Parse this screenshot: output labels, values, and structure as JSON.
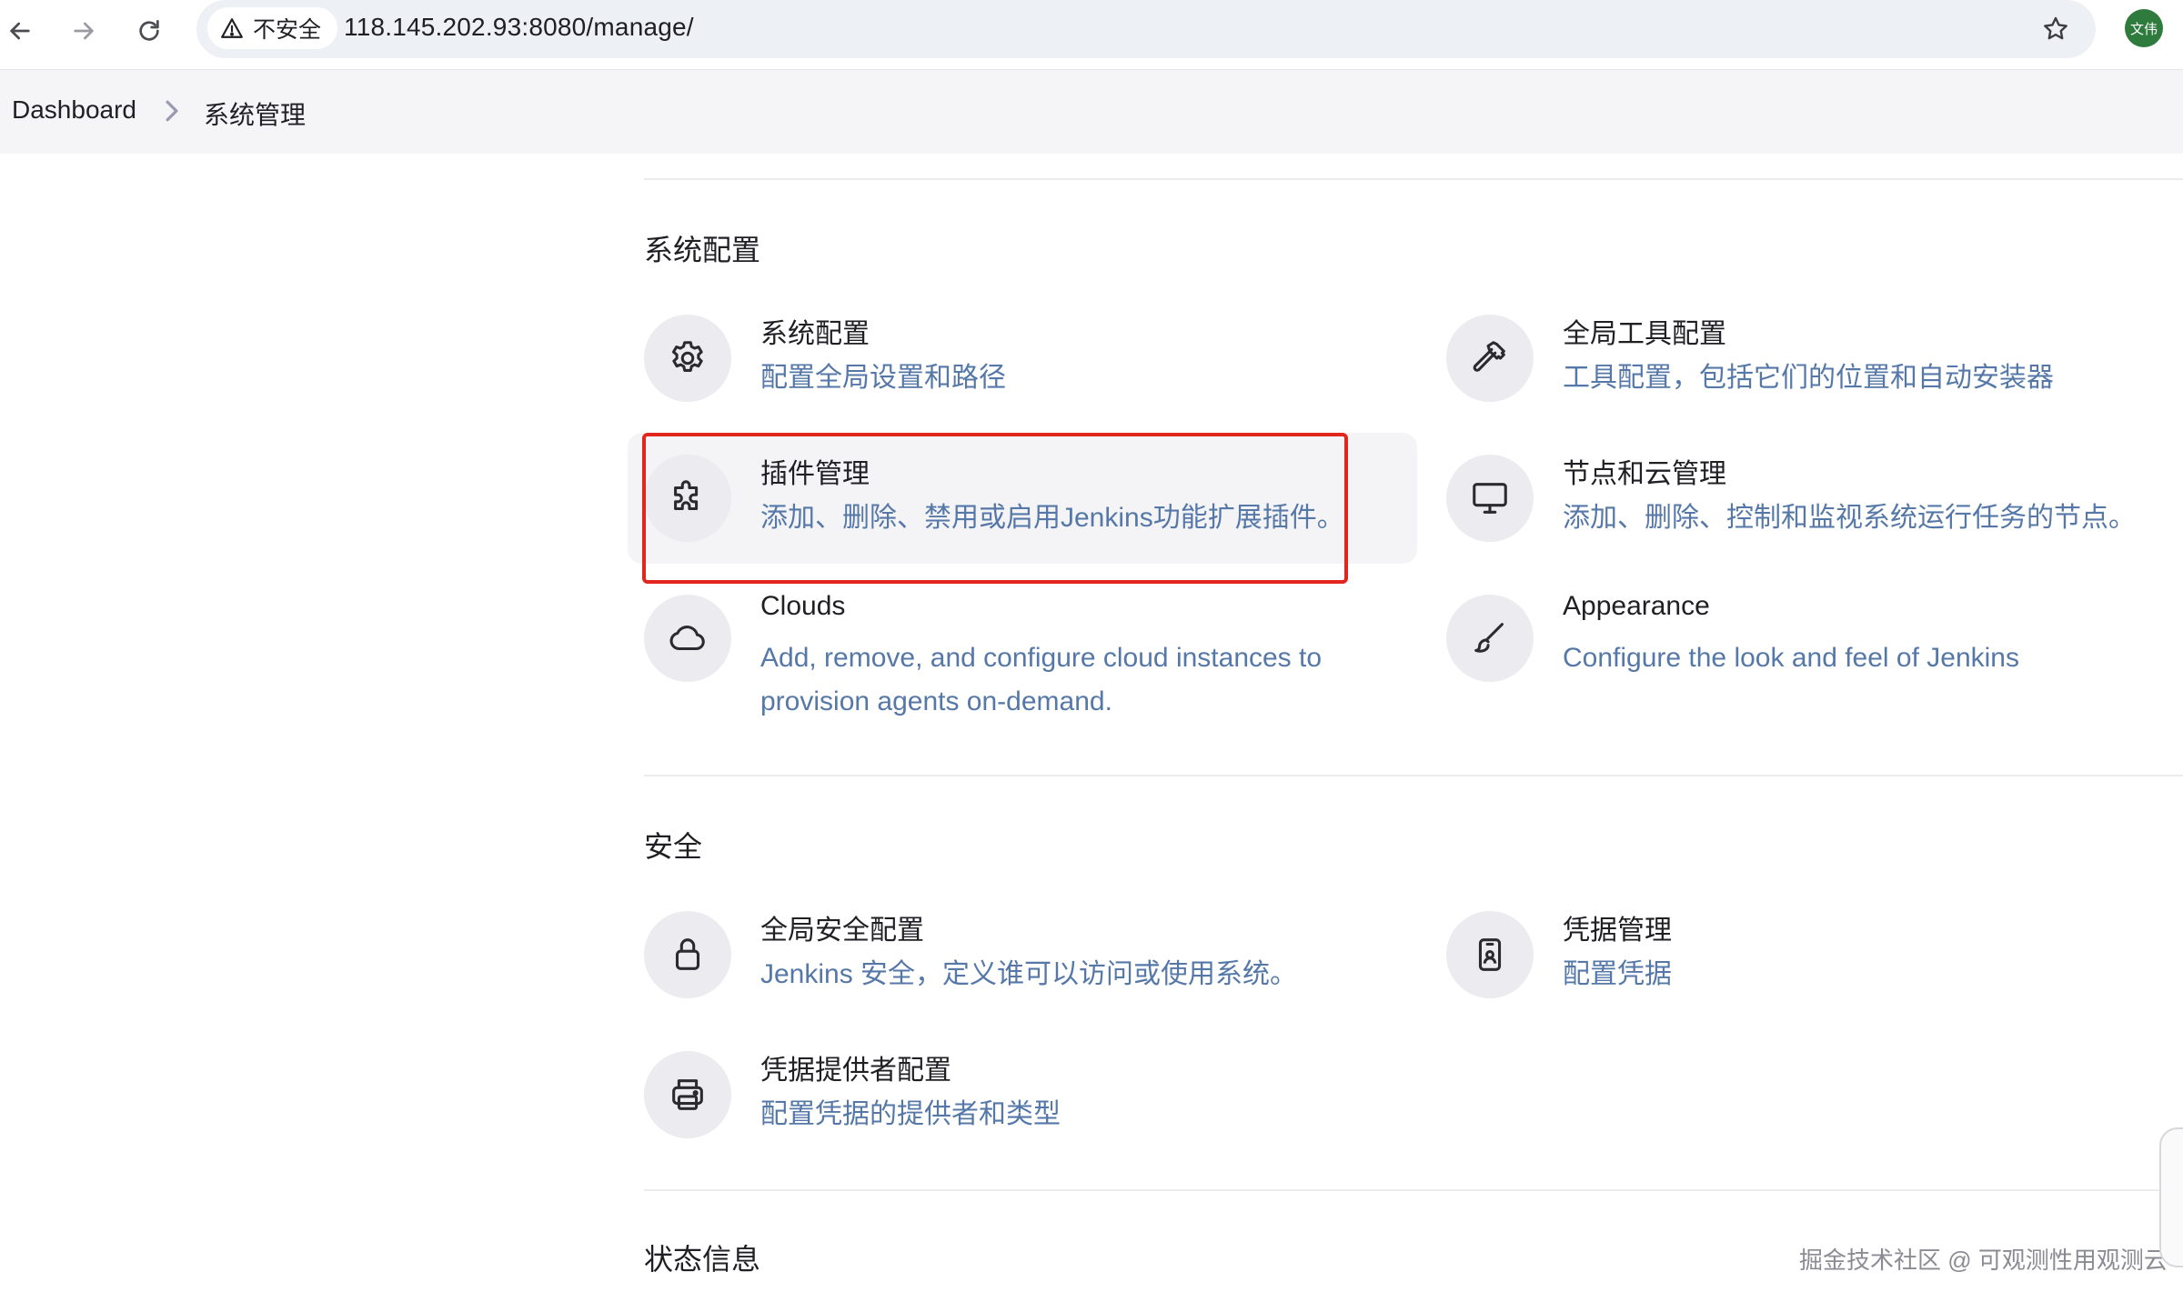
{
  "browser": {
    "security_label": "不安全",
    "url": "118.145.202.93:8080/manage/",
    "avatar_text": "文伟"
  },
  "breadcrumb": {
    "items": [
      "Dashboard",
      "系统管理"
    ]
  },
  "sections": [
    {
      "title": "系统配置",
      "items": [
        {
          "title": "系统配置",
          "desc": "配置全局设置和路径",
          "icon": "gear-icon"
        },
        {
          "title": "全局工具配置",
          "desc": "工具配置，包括它们的位置和自动安装器",
          "icon": "hammer-icon"
        },
        {
          "title": "插件管理",
          "desc": "添加、删除、禁用或启用Jenkins功能扩展插件。",
          "icon": "puzzle-icon"
        },
        {
          "title": "节点和云管理",
          "desc": "添加、删除、控制和监视系统运行任务的节点。",
          "icon": "monitor-icon"
        },
        {
          "title": "Clouds",
          "desc": "Add, remove, and configure cloud instances to provision agents on-demand.",
          "icon": "cloud-icon"
        },
        {
          "title": "Appearance",
          "desc": "Configure the look and feel of Jenkins",
          "icon": "brush-icon"
        }
      ]
    },
    {
      "title": "安全",
      "items": [
        {
          "title": "全局安全配置",
          "desc": "Jenkins 安全，定义谁可以访问或使用系统。",
          "icon": "lock-icon"
        },
        {
          "title": "凭据管理",
          "desc": "配置凭据",
          "icon": "id-badge-icon"
        },
        {
          "title": "凭据提供者配置",
          "desc": "配置凭据的提供者和类型",
          "icon": "printer-icon"
        }
      ]
    },
    {
      "title": "状态信息",
      "items": []
    }
  ],
  "watermark": "掘金技术社区 @ 可观测性用观测云",
  "colors": {
    "link_desc": "#5578a8",
    "highlight": "#e3261d",
    "avatar_bg": "#2f7a3d"
  }
}
